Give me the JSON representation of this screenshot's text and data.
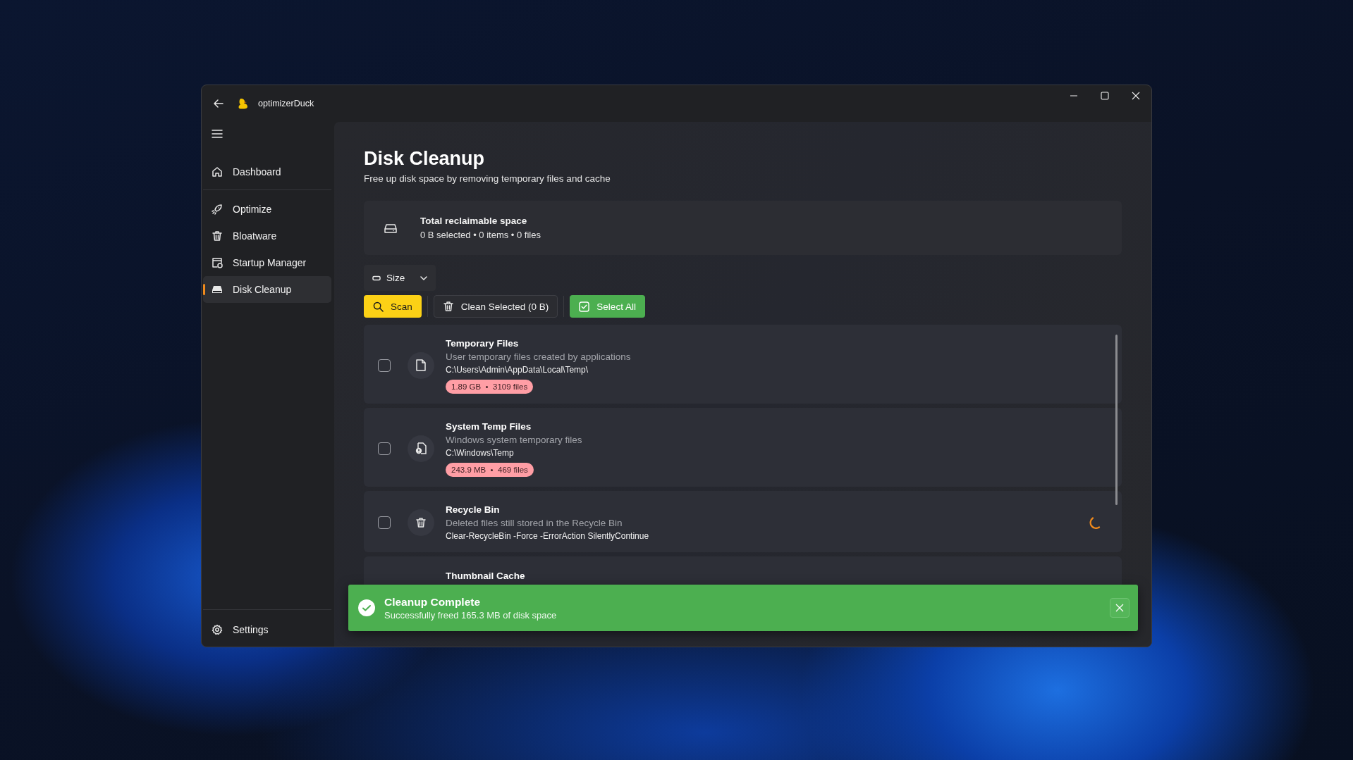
{
  "window": {
    "title": "optimizerDuck"
  },
  "sidebar": {
    "items": [
      {
        "label": "Dashboard",
        "selected": false
      },
      {
        "label": "Optimize",
        "selected": false
      },
      {
        "label": "Bloatware",
        "selected": false
      },
      {
        "label": "Startup Manager",
        "selected": false
      },
      {
        "label": "Disk Cleanup",
        "selected": true
      }
    ],
    "footer": {
      "label": "Settings"
    }
  },
  "page": {
    "title": "Disk Cleanup",
    "subtitle": "Free up disk space by removing temporary files and cache"
  },
  "summary": {
    "title": "Total reclaimable space",
    "detail": "0 B selected • 0 items • 0 files"
  },
  "sort": {
    "value": "Size"
  },
  "toolbar": {
    "buttons": [
      {
        "label": "Scan",
        "kind": "scan"
      },
      {
        "label": "Clean Selected (0 B)",
        "kind": "clean"
      },
      {
        "label": "Select All",
        "kind": "select"
      }
    ]
  },
  "items": [
    {
      "kind": "file",
      "title": "Temporary Files",
      "description": "User temporary files created by applications",
      "path": "C:\\Users\\Admin\\AppData\\Local\\Temp\\",
      "badge": "1.89 GB  •  3109 files",
      "checked": false,
      "loading": false
    },
    {
      "kind": "system",
      "title": "System Temp Files",
      "description": "Windows system temporary files",
      "path": "C:\\Windows\\Temp",
      "badge": "243.9 MB  •  469 files",
      "checked": false,
      "loading": false
    },
    {
      "kind": "trash",
      "title": "Recycle Bin",
      "description": "Deleted files still stored in the Recycle Bin",
      "path": "Clear-RecycleBin -Force -ErrorAction SilentlyContinue",
      "checked": false,
      "loading": true
    },
    {
      "kind": "none",
      "title": "Thumbnail Cache"
    }
  ],
  "toast": {
    "title": "Cleanup Complete",
    "message": "Successfully freed 165.3 MB of disk space"
  }
}
